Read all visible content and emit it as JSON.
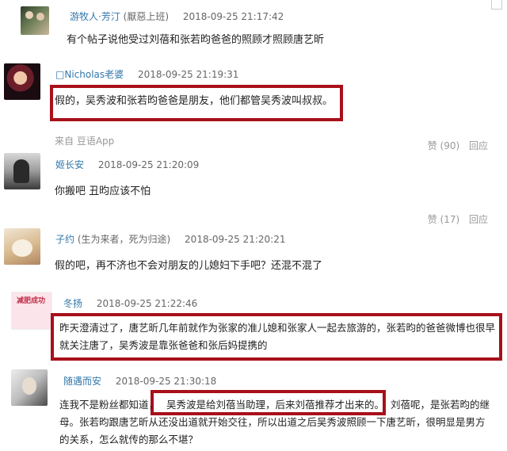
{
  "comments": [
    {
      "author": "游牧人·芳汀",
      "note": "(厭惡上班)",
      "time": "2018-09-25 21:17:42",
      "text": "有个帖子说他受过刘蓓和张若昀爸爸的照顾才照顾唐艺昕"
    },
    {
      "author": "□Nicholas老婆",
      "time": "2018-09-25 21:19:31",
      "text": "假的，吴秀波和张若昀爸爸是朋友，他们都管吴秀波叫叔叔。",
      "source": "来自 豆语App",
      "likes": "赞 (90)",
      "reply": "回应"
    },
    {
      "author": "姬长安",
      "time": "2018-09-25 21:20:09",
      "text": "你搬吧 丑昀应该不怕",
      "likes": "赞 (17)",
      "reply": "回应"
    },
    {
      "author": "子约",
      "note": "(生为来者，死为归途)",
      "time": "2018-09-25 21:20:21",
      "text": "假的吧，再不济也不会对朋友的儿媳妇下手吧？还混不混了"
    },
    {
      "author": "冬扬",
      "time": "2018-09-25 21:22:46",
      "avatar_text": "减肥成功",
      "text_line1": "昨天澄清过了，唐艺昕几年前就作为张家的准儿媳和张家人一起去旅游的，张若昀的爸爸微博也很早",
      "text_line2": "就关注唐了，吴秀波是靠张爸爸和张后妈提携的"
    },
    {
      "author": "随遇而安",
      "time": "2018-09-25 21:30:18",
      "text_line1a": "连我不是粉丝都知道，",
      "text_line1b": "吴秀波是给刘蓓当助理，后来刘蓓推荐才出来的。",
      "text_line1c": "刘蓓呢，是张若昀的继",
      "text_line2": "母。张若昀跟唐艺昕从还没出道就开始交往，所以出道之后吴秀波照顾一下唐艺昕，很明显是男方",
      "text_line3": "的关系，怎么就传的那么不堪？"
    }
  ]
}
